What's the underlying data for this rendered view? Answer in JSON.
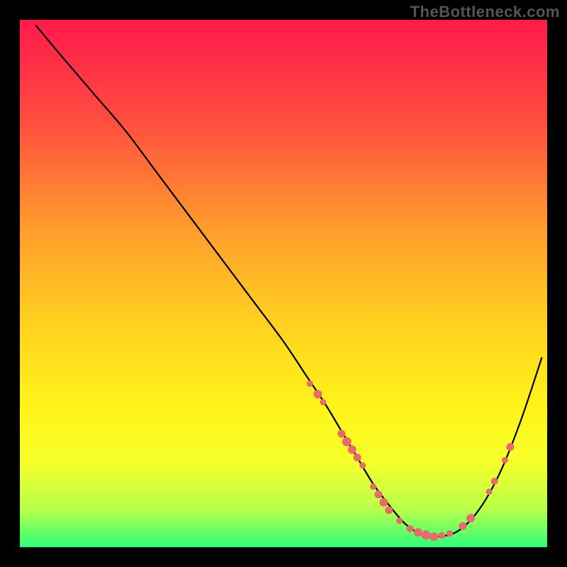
{
  "watermark": "TheBottleneck.com",
  "chart_data": {
    "type": "line",
    "title": "",
    "xlabel": "",
    "ylabel": "",
    "xlim": [
      0,
      100
    ],
    "ylim": [
      0,
      100
    ],
    "gradient_stops": [
      {
        "offset": 0,
        "color": "#ff1a4b"
      },
      {
        "offset": 18,
        "color": "#ff4940"
      },
      {
        "offset": 40,
        "color": "#ff9e2c"
      },
      {
        "offset": 58,
        "color": "#ffd21f"
      },
      {
        "offset": 74,
        "color": "#fff51a"
      },
      {
        "offset": 84,
        "color": "#f6ff2a"
      },
      {
        "offset": 93,
        "color": "#b6ff4a"
      },
      {
        "offset": 100,
        "color": "#2dff7a"
      }
    ],
    "series": [
      {
        "name": "bottleneck-curve",
        "x": [
          3,
          8,
          14,
          20,
          26,
          32,
          38,
          44,
          50,
          54,
          58,
          61,
          64,
          67,
          70,
          73,
          76,
          79,
          83,
          87,
          91,
          95,
          99
        ],
        "y": [
          99,
          93,
          86,
          79,
          71,
          63,
          55,
          47,
          39,
          33,
          27,
          22,
          17,
          12,
          8,
          4.5,
          2.5,
          2,
          3,
          7,
          14,
          24,
          36
        ]
      }
    ],
    "markers": [
      {
        "x": 55.0,
        "y": 31.0,
        "r": 4.5
      },
      {
        "x": 56.5,
        "y": 29.0,
        "r": 6.0
      },
      {
        "x": 57.5,
        "y": 27.5,
        "r": 4.5
      },
      {
        "x": 61.0,
        "y": 21.5,
        "r": 5.5
      },
      {
        "x": 62.0,
        "y": 20.0,
        "r": 6.5
      },
      {
        "x": 63.0,
        "y": 18.5,
        "r": 6.0
      },
      {
        "x": 64.0,
        "y": 17.0,
        "r": 5.5
      },
      {
        "x": 65.0,
        "y": 15.5,
        "r": 4.5
      },
      {
        "x": 67.0,
        "y": 11.5,
        "r": 4.5
      },
      {
        "x": 68.0,
        "y": 10.0,
        "r": 5.5
      },
      {
        "x": 69.0,
        "y": 8.5,
        "r": 6.0
      },
      {
        "x": 70.0,
        "y": 7.0,
        "r": 5.5
      },
      {
        "x": 72.0,
        "y": 5.0,
        "r": 4.5
      },
      {
        "x": 74.0,
        "y": 3.5,
        "r": 5.0
      },
      {
        "x": 75.5,
        "y": 2.8,
        "r": 6.0
      },
      {
        "x": 77.0,
        "y": 2.3,
        "r": 6.5
      },
      {
        "x": 78.5,
        "y": 2.0,
        "r": 6.0
      },
      {
        "x": 80.0,
        "y": 2.2,
        "r": 5.0
      },
      {
        "x": 81.5,
        "y": 2.6,
        "r": 4.5
      },
      {
        "x": 84.0,
        "y": 4.0,
        "r": 5.5
      },
      {
        "x": 85.5,
        "y": 5.5,
        "r": 6.0
      },
      {
        "x": 89.0,
        "y": 10.5,
        "r": 4.5
      },
      {
        "x": 90.0,
        "y": 12.5,
        "r": 5.0
      },
      {
        "x": 92.0,
        "y": 16.5,
        "r": 4.5
      },
      {
        "x": 93.0,
        "y": 19.0,
        "r": 5.5
      }
    ],
    "marker_color": "#e86a6a",
    "curve_color": "#000000",
    "curve_width": 2.2
  }
}
